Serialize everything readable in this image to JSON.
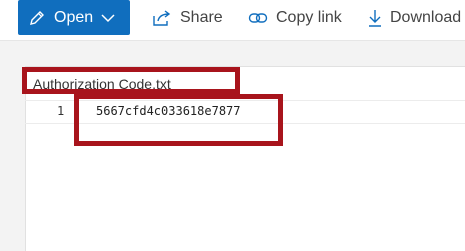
{
  "toolbar": {
    "open_label": "Open",
    "share_label": "Share",
    "copy_link_label": "Copy link",
    "download_label": "Download"
  },
  "file": {
    "name": "Authorization Code.txt",
    "lines": [
      {
        "number": "1",
        "text": "5667cfd4c033618e7877"
      }
    ]
  },
  "colors": {
    "open_button": "#106ebe",
    "highlight": "#a8141c"
  }
}
